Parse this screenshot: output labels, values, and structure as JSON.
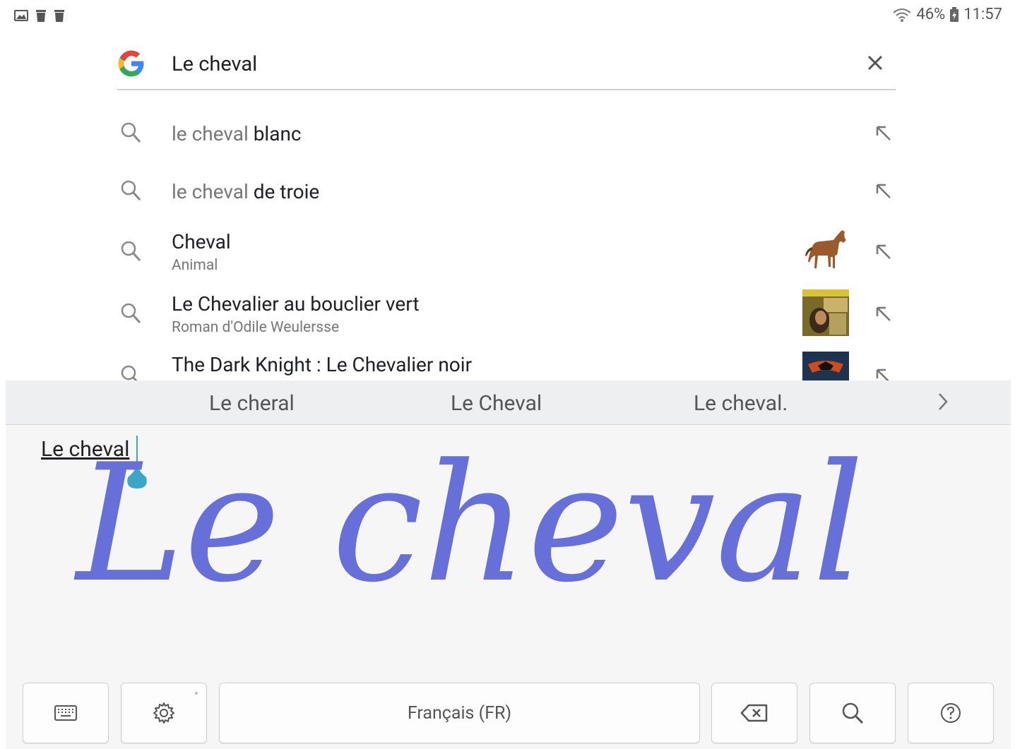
{
  "status_bar": {
    "left_icons": [
      "image-notification-icon",
      "trash-icon",
      "trash-icon"
    ],
    "battery": "46%",
    "time": "11:57"
  },
  "search": {
    "query": "Le cheval"
  },
  "suggestions": [
    {
      "prefix": "le cheval",
      "suffix": " blanc"
    },
    {
      "prefix": "le cheval",
      "suffix": " de troie"
    },
    {
      "title": "Cheval",
      "subtitle": "Animal",
      "thumbnail": "horse"
    },
    {
      "title": "Le Chevalier au bouclier vert",
      "subtitle": "Roman d'Odile Weulersse",
      "thumbnail": "book-cover"
    },
    {
      "title": "The Dark Knight : Le Chevalier noir",
      "thumbnail": "movie-poster"
    }
  ],
  "keyboard": {
    "candidates": [
      "Le cheral",
      "Le Cheval",
      "Le cheval."
    ],
    "recognized_text": "Le cheval",
    "handwriting": "Le cheval",
    "space_label": "Français (FR)",
    "ink_color": "#6670d8",
    "cursor_color": "#3aa6c8"
  },
  "colors": {
    "google_blue": "#4285F4",
    "google_red": "#EA4335",
    "google_yellow": "#FBBC05",
    "google_green": "#34A853"
  }
}
